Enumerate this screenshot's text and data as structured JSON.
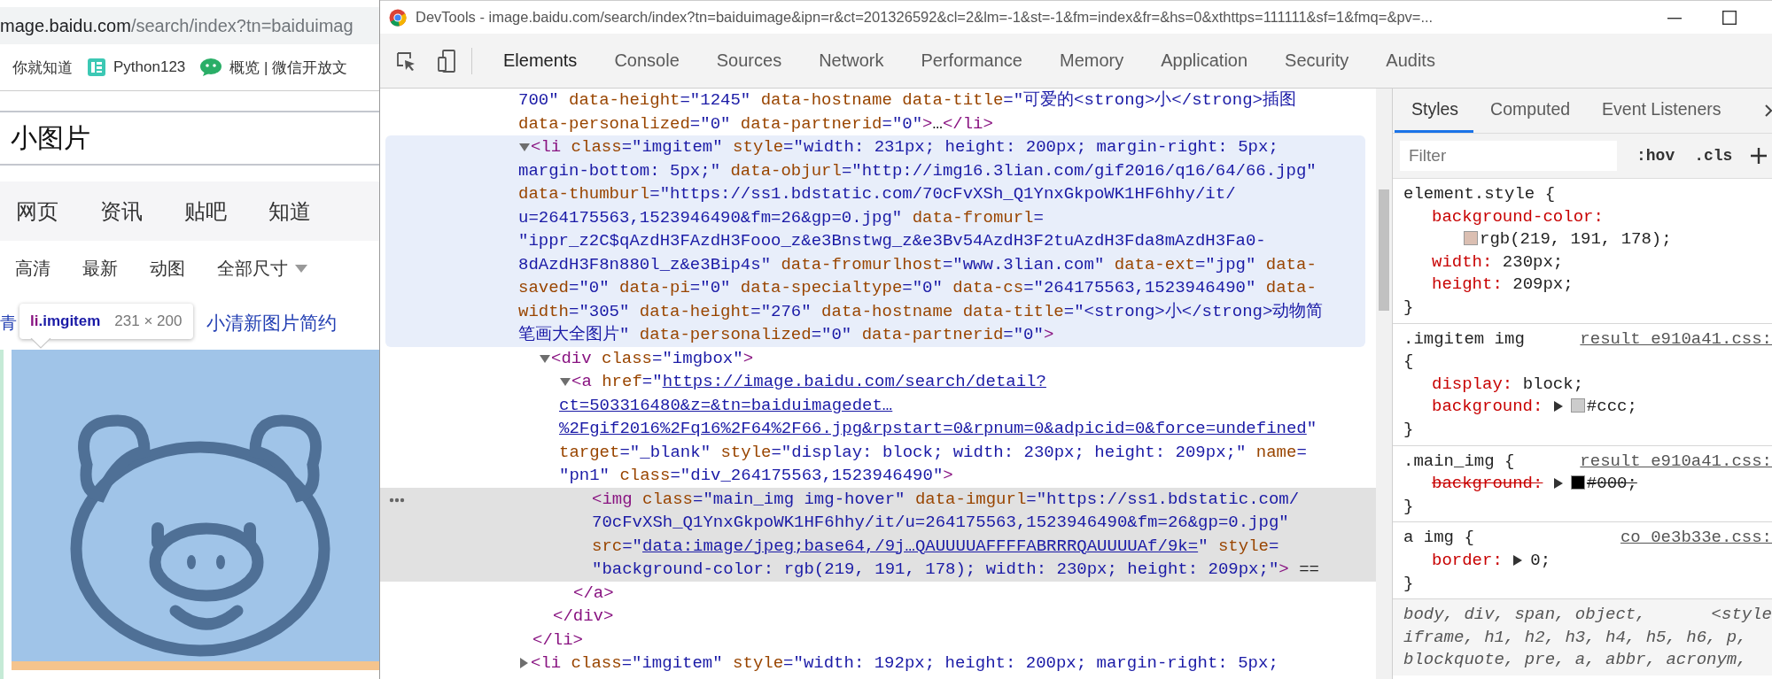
{
  "browser": {
    "address": {
      "host": "mage.baidu.com",
      "path": "/search/index?tn=baiduimag"
    },
    "bookmarks": [
      {
        "label": "你就知道",
        "kind": "plain"
      },
      {
        "label": "Python123",
        "kind": "python"
      },
      {
        "label": "概览 | 微信开放文",
        "kind": "wechat"
      }
    ],
    "search": {
      "value": "小图片"
    },
    "nav": [
      {
        "label": "网页"
      },
      {
        "label": "资讯"
      },
      {
        "label": "贴吧"
      },
      {
        "label": "知道"
      }
    ],
    "filters": [
      {
        "label": "高清",
        "dropdown": false
      },
      {
        "label": "最新",
        "dropdown": false
      },
      {
        "label": "动图",
        "dropdown": false
      },
      {
        "label": "全部尺寸",
        "dropdown": true
      }
    ],
    "related": [
      {
        "label": "青"
      },
      {
        "label": "小清新图片简约"
      }
    ],
    "inspect_tooltip": {
      "tag": "li",
      "class": ".imgitem",
      "size": "231 × 200"
    }
  },
  "devtools": {
    "title": "DevTools - image.baidu.com/search/index?tn=baiduimage&ipn=r&ct=201326592&cl=2&lm=-1&st=-1&fm=index&fr=&hs=0&xthttps=111111&sf=1&fmq=&pv=...",
    "tabs": [
      {
        "label": "Elements",
        "selected": true
      },
      {
        "label": "Console",
        "selected": false
      },
      {
        "label": "Sources",
        "selected": false
      },
      {
        "label": "Network",
        "selected": false
      },
      {
        "label": "Performance",
        "selected": false
      },
      {
        "label": "Memory",
        "selected": false
      },
      {
        "label": "Application",
        "selected": false
      },
      {
        "label": "Security",
        "selected": false
      },
      {
        "label": "Audits",
        "selected": false
      }
    ],
    "elements": {
      "nodes": [
        {
          "kind": "tail",
          "hovered": false,
          "selected": false,
          "lines": [
            [
              {
                "kind": "value",
                "text": "700\""
              },
              {
                "kind": "attr",
                "text": " data-height"
              },
              {
                "kind": "value",
                "text": "=\"1245\""
              },
              {
                "kind": "attr",
                "text": " data-hostname data-title"
              },
              {
                "kind": "value",
                "text": "=\"可爱的<strong>小</strong>插图"
              }
            ],
            [
              {
                "kind": "attr",
                "text": "data-personalized"
              },
              {
                "kind": "value",
                "text": "=\"0\""
              },
              {
                "kind": "attr",
                "text": " data-partnerid"
              },
              {
                "kind": "value",
                "text": "=\"0\""
              },
              {
                "kind": "tag",
                "text": ">"
              },
              {
                "kind": "text",
                "text": "…"
              },
              {
                "kind": "tag",
                "text": "</li>"
              }
            ]
          ]
        },
        {
          "kind": "element",
          "expanded": true,
          "hovered": true,
          "selected": false,
          "lines": [
            [
              {
                "kind": "tag",
                "text": "<li"
              },
              {
                "kind": "attr",
                "text": " class"
              },
              {
                "kind": "value",
                "text": "=\"imgitem\""
              },
              {
                "kind": "attr",
                "text": " style"
              },
              {
                "kind": "value",
                "text": "=\"width: 231px; height: 200px; margin-right: 5px;"
              }
            ],
            [
              {
                "kind": "value",
                "text": "margin-bottom: 5px;\""
              },
              {
                "kind": "attr",
                "text": " data-objurl"
              },
              {
                "kind": "value",
                "text": "=\"http://img16.3lian.com/gif2016/q16/64/66.jpg\""
              }
            ],
            [
              {
                "kind": "attr",
                "text": "data-thumburl"
              },
              {
                "kind": "value",
                "text": "=\"https://ss1.bdstatic.com/70cFvXSh_Q1YnxGkpoWK1HF6hhy/it/"
              }
            ],
            [
              {
                "kind": "value",
                "text": "u=264175563,1523946490&fm=26&gp=0.jpg\""
              },
              {
                "kind": "attr",
                "text": " data-fromurl"
              },
              {
                "kind": "value",
                "text": "="
              }
            ],
            [
              {
                "kind": "value",
                "text": "\"ippr_z2C$qAzdH3FAzdH3Fooo_z&e3Bnstwg_z&e3Bv54AzdH3F2tuAzdH3Fda8mAzdH3Fa0-"
              }
            ],
            [
              {
                "kind": "value",
                "text": "8dAzdH3F8n880l_z&e3Bip4s\""
              },
              {
                "kind": "attr",
                "text": " data-fromurlhost"
              },
              {
                "kind": "value",
                "text": "=\"www.3lian.com\""
              },
              {
                "kind": "attr",
                "text": " data-ext"
              },
              {
                "kind": "value",
                "text": "=\"jpg\""
              },
              {
                "kind": "attr",
                "text": " data-"
              }
            ],
            [
              {
                "kind": "attr",
                "text": "saved"
              },
              {
                "kind": "value",
                "text": "=\"0\""
              },
              {
                "kind": "attr",
                "text": " data-pi"
              },
              {
                "kind": "value",
                "text": "=\"0\""
              },
              {
                "kind": "attr",
                "text": " data-specialtype"
              },
              {
                "kind": "value",
                "text": "=\"0\""
              },
              {
                "kind": "attr",
                "text": " data-cs"
              },
              {
                "kind": "value",
                "text": "=\"264175563,1523946490\""
              },
              {
                "kind": "attr",
                "text": " data-"
              }
            ],
            [
              {
                "kind": "attr",
                "text": "width"
              },
              {
                "kind": "value",
                "text": "=\"305\""
              },
              {
                "kind": "attr",
                "text": " data-height"
              },
              {
                "kind": "value",
                "text": "=\"276\""
              },
              {
                "kind": "attr",
                "text": " data-hostname data-title"
              },
              {
                "kind": "value",
                "text": "=\"<strong>小</strong>动物简"
              }
            ],
            [
              {
                "kind": "value",
                "text": "笔画大全图片\""
              },
              {
                "kind": "attr",
                "text": " data-personalized"
              },
              {
                "kind": "value",
                "text": "=\"0\""
              },
              {
                "kind": "attr",
                "text": " data-partnerid"
              },
              {
                "kind": "value",
                "text": "=\"0\""
              },
              {
                "kind": "tag",
                "text": ">"
              }
            ]
          ],
          "children": [
            {
              "kind": "element",
              "expanded": true,
              "hovered": false,
              "selected": false,
              "lines": [
                [
                  {
                    "kind": "tag",
                    "text": "<div"
                  },
                  {
                    "kind": "attr",
                    "text": " class"
                  },
                  {
                    "kind": "value",
                    "text": "=\"imgbox\""
                  },
                  {
                    "kind": "tag",
                    "text": ">"
                  }
                ]
              ],
              "children": [
                {
                  "kind": "element",
                  "expanded": true,
                  "hovered": false,
                  "selected": false,
                  "lines": [
                    [
                      {
                        "kind": "tag",
                        "text": "<a"
                      },
                      {
                        "kind": "attr",
                        "text": " href"
                      },
                      {
                        "kind": "value",
                        "text": "=\""
                      },
                      {
                        "kind": "link",
                        "text": "https://image.baidu.com/search/detail?"
                      }
                    ],
                    [
                      {
                        "kind": "link",
                        "text": "ct=503316480&z=&tn=baiduimagedet…"
                      }
                    ],
                    [
                      {
                        "kind": "link",
                        "text": "%2Fgif2016%2Fq16%2F64%2F66.jpg&rpstart=0&rpnum=0&adpicid=0&force=undefined"
                      },
                      {
                        "kind": "value",
                        "text": "\""
                      }
                    ],
                    [
                      {
                        "kind": "attr",
                        "text": "target"
                      },
                      {
                        "kind": "value",
                        "text": "=\"_blank\""
                      },
                      {
                        "kind": "attr",
                        "text": " style"
                      },
                      {
                        "kind": "value",
                        "text": "=\"display: block; width: 230px; height: 209px;\""
                      },
                      {
                        "kind": "attr",
                        "text": " name"
                      },
                      {
                        "kind": "value",
                        "text": "="
                      }
                    ],
                    [
                      {
                        "kind": "value",
                        "text": "\"pn1\""
                      },
                      {
                        "kind": "attr",
                        "text": " class"
                      },
                      {
                        "kind": "value",
                        "text": "=\"div_264175563,1523946490\""
                      },
                      {
                        "kind": "tag",
                        "text": ">"
                      }
                    ]
                  ],
                  "children": [
                    {
                      "kind": "leaf",
                      "hovered": false,
                      "selected": true,
                      "lines": [
                        [
                          {
                            "kind": "tag",
                            "text": "<img"
                          },
                          {
                            "kind": "attr",
                            "text": " class"
                          },
                          {
                            "kind": "value",
                            "text": "=\"main_img img-hover\""
                          },
                          {
                            "kind": "attr",
                            "text": " data-imgurl"
                          },
                          {
                            "kind": "value",
                            "text": "=\"https://ss1.bdstatic.com/"
                          }
                        ],
                        [
                          {
                            "kind": "value",
                            "text": "70cFvXSh_Q1YnxGkpoWK1HF6hhy/it/u=264175563,1523946490&fm=26&gp=0.jpg\""
                          }
                        ],
                        [
                          {
                            "kind": "attr",
                            "text": "src"
                          },
                          {
                            "kind": "value",
                            "text": "=\""
                          },
                          {
                            "kind": "link",
                            "text": "data:image/jpeg;base64,/9j…QAUUUUAFFFFABRRRQAUUUUAf/9k="
                          },
                          {
                            "kind": "value",
                            "text": "\""
                          },
                          {
                            "kind": "attr",
                            "text": " style"
                          },
                          {
                            "kind": "value",
                            "text": "="
                          }
                        ],
                        [
                          {
                            "kind": "value",
                            "text": "\"background-color: rgb(219, 191, 178); width: 230px; height: 209px;\""
                          },
                          {
                            "kind": "tag",
                            "text": ">"
                          },
                          {
                            "kind": "text",
                            "text": " =="
                          }
                        ]
                      ]
                    }
                  ],
                  "close": [
                    {
                      "kind": "tag",
                      "text": "</a>"
                    }
                  ]
                }
              ],
              "close": [
                {
                  "kind": "tag",
                  "text": "</div>"
                }
              ]
            }
          ],
          "close": [
            {
              "kind": "tag",
              "text": "</li>"
            }
          ]
        },
        {
          "kind": "element",
          "expanded": false,
          "hovered": false,
          "selected": false,
          "lines": [
            [
              {
                "kind": "tag",
                "text": "<li"
              },
              {
                "kind": "attr",
                "text": " class"
              },
              {
                "kind": "value",
                "text": "=\"imgitem\""
              },
              {
                "kind": "attr",
                "text": " style"
              },
              {
                "kind": "value",
                "text": "=\"width: 192px; height: 200px; margin-right: 5px;"
              }
            ]
          ]
        }
      ]
    },
    "styles": {
      "tabs": [
        {
          "label": "Styles",
          "selected": true
        },
        {
          "label": "Computed",
          "selected": false
        },
        {
          "label": "Event Listeners",
          "selected": false
        }
      ],
      "filter": {
        "placeholder": "Filter"
      },
      "toggles": [
        ":hov",
        ".cls"
      ],
      "rules": [
        {
          "kind": "author",
          "selector_lines": [
            "element.style {"
          ],
          "declarations": [
            {
              "property": "background-color:",
              "value": "rgb(219, 191, 178);",
              "color": "#dbbfb2",
              "expandable": false,
              "overridden": false
            },
            {
              "property": "width:",
              "value": "230px;",
              "expandable": false,
              "overridden": false
            },
            {
              "property": "height:",
              "value": "209px;",
              "expandable": false,
              "overridden": false
            }
          ],
          "close": "}"
        },
        {
          "kind": "author",
          "selector_lines": [
            ".imgitem img",
            "{"
          ],
          "source": "result_e910a41.css:",
          "declarations": [
            {
              "property": "display:",
              "value": "block;",
              "expandable": false,
              "overridden": false
            },
            {
              "property": "background:",
              "value": "#ccc;",
              "color": "#cccccc",
              "expandable": true,
              "overridden": false
            }
          ],
          "close": "}"
        },
        {
          "kind": "author",
          "selector_lines": [
            ".main_img {"
          ],
          "source": "result_e910a41.css:",
          "declarations": [
            {
              "property": "background:",
              "value": "#000;",
              "color": "#000000",
              "expandable": true,
              "overridden": true
            }
          ],
          "close": "}"
        },
        {
          "kind": "author",
          "selector_lines": [
            "a img {"
          ],
          "source": "co_0e3b33e.css:",
          "declarations": [
            {
              "property": "border:",
              "value": "0;",
              "expandable": true,
              "overridden": false
            }
          ],
          "close": "}"
        },
        {
          "kind": "user_agent",
          "selector_lines": [
            "body, div, span, object,",
            "iframe, h1, h2, h3, h4, h5, h6, p,",
            "blockquote, pre, a, abbr, acronym,"
          ],
          "source": "<style"
        }
      ]
    }
  }
}
